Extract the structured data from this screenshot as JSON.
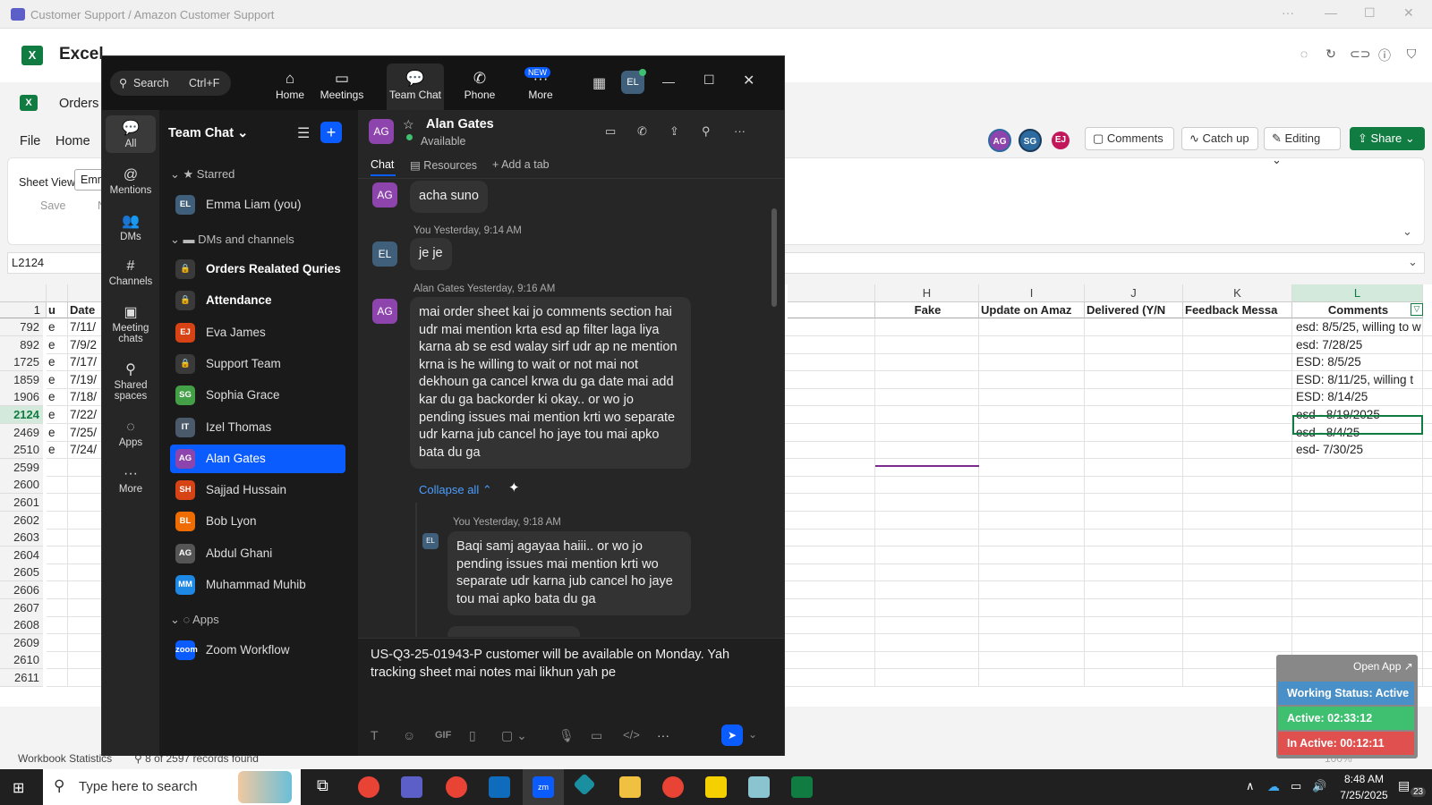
{
  "teams_bar": {
    "title": "Customer Support / Amazon Customer Support",
    "ctrl_more": "···",
    "ctrl_min": "—",
    "ctrl_max": "☐",
    "ctrl_close": "✕"
  },
  "excel": {
    "app_name": "Excel",
    "logo": "X",
    "file_name": "Orders",
    "tabs": {
      "file": "File",
      "home": "Home"
    },
    "sheet_view_label": "Sheet View",
    "sheet_view_value": "Emm",
    "save_label": "Save",
    "new_label": "Ne",
    "name_box": "L2124",
    "buttons": {
      "comments": "Comments",
      "catch_up": "Catch up",
      "editing": "Editing",
      "share": "Share"
    },
    "avatars": [
      {
        "initials": "AG",
        "color": "#8e44ad"
      },
      {
        "initials": "SG",
        "color": "#2c6aa0"
      },
      {
        "initials": "EJ",
        "color": "#c2185b"
      }
    ],
    "columns": [
      {
        "letter": "H",
        "header": "Fake"
      },
      {
        "letter": "I",
        "header": "Update on Amaz"
      },
      {
        "letter": "J",
        "header": "Delivered (Y/N"
      },
      {
        "letter": "K",
        "header": "Feedback Messa"
      },
      {
        "letter": "L",
        "header": "Comments"
      }
    ],
    "left_headers": {
      "col1": "1",
      "u": "u",
      "date": "Date"
    },
    "rows": [
      {
        "num": "792",
        "a": "e",
        "date": "7/11/",
        "comment": "esd: 8/5/25, willing to w"
      },
      {
        "num": "892",
        "a": "e",
        "date": "7/9/2",
        "comment": "esd: 7/28/25"
      },
      {
        "num": "1725",
        "a": "e",
        "date": "7/17/",
        "comment": " ESD:  8/5/25"
      },
      {
        "num": "1859",
        "a": "e",
        "date": "7/19/",
        "comment": "ESD: 8/11/25, willing t"
      },
      {
        "num": "1906",
        "a": "e",
        "date": "7/18/",
        "comment": "ESD: 8/14/25"
      },
      {
        "num": "2124",
        "a": "e",
        "date": "7/22/",
        "comment": "esd - 8/19/2025"
      },
      {
        "num": "2469",
        "a": "e",
        "date": "7/25/",
        "comment": "esd -  8/4/25"
      },
      {
        "num": "2510",
        "a": "e",
        "date": "7/24/",
        "comment": "esd- 7/30/25"
      },
      {
        "num": "2599",
        "a": "",
        "date": "",
        "comment": ""
      },
      {
        "num": "2600",
        "a": "",
        "date": "",
        "comment": ""
      },
      {
        "num": "2601",
        "a": "",
        "date": "",
        "comment": ""
      },
      {
        "num": "2602",
        "a": "",
        "date": "",
        "comment": ""
      },
      {
        "num": "2603",
        "a": "",
        "date": "",
        "comment": ""
      },
      {
        "num": "2604",
        "a": "",
        "date": "",
        "comment": ""
      },
      {
        "num": "2605",
        "a": "",
        "date": "",
        "comment": ""
      },
      {
        "num": "2606",
        "a": "",
        "date": "",
        "comment": ""
      },
      {
        "num": "2607",
        "a": "",
        "date": "",
        "comment": ""
      },
      {
        "num": "2608",
        "a": "",
        "date": "",
        "comment": ""
      },
      {
        "num": "2609",
        "a": "",
        "date": "",
        "comment": ""
      },
      {
        "num": "2610",
        "a": "",
        "date": "",
        "comment": ""
      },
      {
        "num": "2611",
        "a": "",
        "date": "",
        "comment": ""
      }
    ],
    "status": {
      "stats": "Workbook Statistics",
      "records": "8 of 2597 records found",
      "zoom": "100%"
    }
  },
  "zoom": {
    "search": {
      "label": "Search",
      "shortcut": "Ctrl+F"
    },
    "nav": [
      {
        "label": "Home",
        "icon": "⌂"
      },
      {
        "label": "Meetings",
        "icon": "▭"
      },
      {
        "label": "Team Chat",
        "icon": "💬"
      },
      {
        "label": "Phone",
        "icon": "✆"
      },
      {
        "label": "More",
        "icon": "···",
        "badge": "NEW"
      }
    ],
    "user_avatar": "EL",
    "rail": [
      {
        "label": "All",
        "icon": "💬"
      },
      {
        "label": "Mentions",
        "icon": "@"
      },
      {
        "label": "DMs",
        "icon": "👥"
      },
      {
        "label": "Channels",
        "icon": "#"
      },
      {
        "label": "Meeting chats",
        "icon": "▣"
      },
      {
        "label": "Shared spaces",
        "icon": "⚲"
      },
      {
        "label": "Apps",
        "icon": "◌"
      },
      {
        "label": "More",
        "icon": "···"
      }
    ],
    "list_title": "Team Chat",
    "sections": {
      "starred": "Starred",
      "dms": "DMs and channels",
      "apps": "Apps"
    },
    "starred": [
      {
        "initials": "EL",
        "name": "Emma Liam (you)",
        "color": "#3f5f7a"
      }
    ],
    "items": [
      {
        "initials": "🔒",
        "name": "Orders Realated Quries",
        "color": "#3a3a3a",
        "bold": true
      },
      {
        "initials": "🔒",
        "name": "Attendance",
        "color": "#3a3a3a",
        "bold": true
      },
      {
        "initials": "EJ",
        "name": "Eva James",
        "color": "#d84315"
      },
      {
        "initials": "🔒",
        "name": "Support Team",
        "color": "#3a3a3a"
      },
      {
        "initials": "SG",
        "name": "Sophia Grace",
        "color": "#43a047"
      },
      {
        "initials": "IT",
        "name": "Izel Thomas",
        "color": "#4a5a6a"
      },
      {
        "initials": "AG",
        "name": "Alan Gates",
        "color": "#8e44ad",
        "active": true
      },
      {
        "initials": "SH",
        "name": "Sajjad Hussain",
        "color": "#d84315"
      },
      {
        "initials": "BL",
        "name": "Bob Lyon",
        "color": "#ef6c00"
      },
      {
        "initials": "AG",
        "name": "Abdul Ghani",
        "color": "#555"
      },
      {
        "initials": "MM",
        "name": "Muhammad Muhib",
        "color": "#1e88e5"
      }
    ],
    "apps": [
      {
        "initials": "zoom",
        "name": "Zoom Workflow",
        "color": "#0b5cff"
      }
    ],
    "chat": {
      "contact": "Alan Gates",
      "contact_initials": "AG",
      "status": "Available",
      "tabs": {
        "chat": "Chat",
        "resources": "Resources",
        "add": "Add a tab"
      },
      "m1": {
        "text": "acha suno"
      },
      "m2": {
        "meta": "You Yesterday, 9:14 AM",
        "text": "je je"
      },
      "m3": {
        "meta": "Alan Gates Yesterday, 9:16 AM",
        "text": "mai order sheet kai jo comments section hai udr mai mention krta esd ap filter laga liya karna ab se esd walay sirf udr ap ne mention krna is he willing to wait or not mai not dekhoun ga cancel krwa du ga date mai add kar du ga backorder ki okay.. or wo jo pending issues mai mention krti wo separate udr karna jub cancel ho jaye tou mai apko bata du ga"
      },
      "collapse": "Collapse all",
      "m4": {
        "meta": "You Yesterday, 9:18 AM",
        "text": "Baqi samj agayaa haiii.. or wo jo pending issues mai mention krti wo separate udr karna jub cancel ho jaye tou mai apko bata du ga"
      },
      "composer_text": "US-Q3-25-01943-P customer will be available on Monday. Yah tracking sheet mai notes mai likhun yah pe"
    }
  },
  "tracker": {
    "open_app": "Open App ↗",
    "working_status": "Working Status: Active",
    "active": "Active: 02:33:12",
    "inactive": "In Active: 00:12:11"
  },
  "taskbar": {
    "search_placeholder": "Type here to search",
    "time": "8:48 AM",
    "date": "7/25/2025",
    "notif": "23"
  },
  "colors": {
    "zoom_blue": "#0b5cff",
    "excel_green": "#107c41",
    "tracker_blue": "#4a90c8",
    "tracker_green": "#3fbf70",
    "tracker_red": "#e0504f"
  }
}
